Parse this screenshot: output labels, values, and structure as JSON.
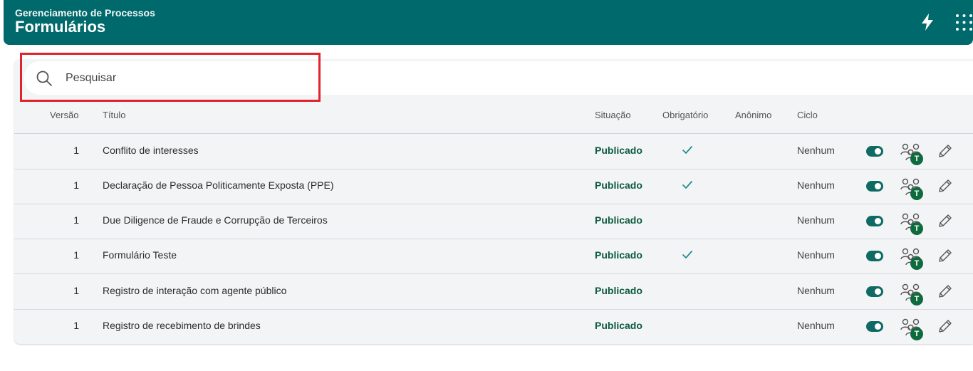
{
  "header": {
    "subtitle": "Gerenciamento de Processos",
    "title": "Formulários",
    "icons": [
      "bolt-icon",
      "apps-grid-icon"
    ]
  },
  "search": {
    "placeholder": "Pesquisar",
    "value": ""
  },
  "table": {
    "columns": [
      "Versão",
      "Título",
      "Situação",
      "Obrigatório",
      "Anônimo",
      "Ciclo"
    ],
    "rows": [
      {
        "version": "1",
        "title": "Conflito de interesses",
        "status": "Publicado",
        "required": true,
        "anonymous": false,
        "cycle": "Nenhum",
        "active": true,
        "badge": "T"
      },
      {
        "version": "1",
        "title": "Declaração de Pessoa Politicamente Exposta (PPE)",
        "status": "Publicado",
        "required": true,
        "anonymous": false,
        "cycle": "Nenhum",
        "active": true,
        "badge": "T"
      },
      {
        "version": "1",
        "title": "Due Diligence de Fraude e Corrupção de Terceiros",
        "status": "Publicado",
        "required": false,
        "anonymous": false,
        "cycle": "Nenhum",
        "active": true,
        "badge": "T"
      },
      {
        "version": "1",
        "title": "Formulário Teste",
        "status": "Publicado",
        "required": true,
        "anonymous": false,
        "cycle": "Nenhum",
        "active": true,
        "badge": "T"
      },
      {
        "version": "1",
        "title": "Registro de interação com agente público",
        "status": "Publicado",
        "required": false,
        "anonymous": false,
        "cycle": "Nenhum",
        "active": true,
        "badge": "T"
      },
      {
        "version": "1",
        "title": "Registro de recebimento de brindes",
        "status": "Publicado",
        "required": false,
        "anonymous": false,
        "cycle": "Nenhum",
        "active": true,
        "badge": "T"
      }
    ]
  },
  "colors": {
    "header_bg": "#00696b",
    "status_text": "#0b5a3c",
    "toggle_on": "#0f6a64",
    "check": "#1a8a8a",
    "badge": "#0d6b3e",
    "highlight": "#e0232c"
  }
}
